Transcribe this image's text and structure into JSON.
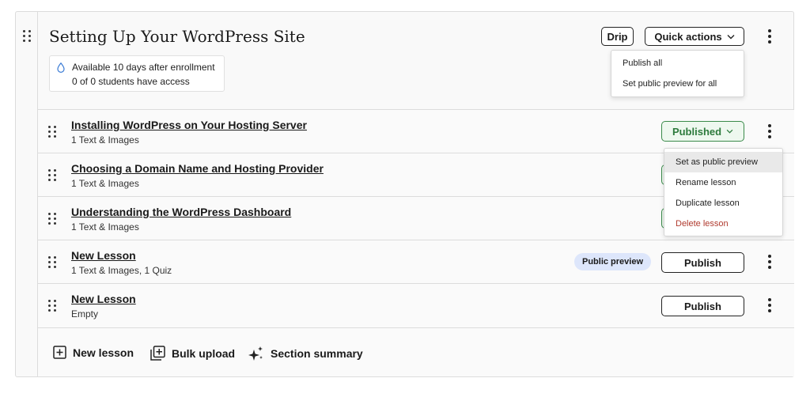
{
  "section": {
    "title": "Setting Up Your WordPress Site",
    "drip_line1": "Available 10 days after enrollment",
    "drip_line2": "0 of 0 students have access",
    "drip_button": "Drip",
    "quick_actions": "Quick actions",
    "quick_menu": [
      "Publish all",
      "Set public preview for all"
    ]
  },
  "lessons": [
    {
      "title": "Installing WordPress on Your Hosting Server",
      "subtitle": "1 Text & Images",
      "status": "Published"
    },
    {
      "title": "Choosing a Domain Name and Hosting Provider",
      "subtitle": "1 Text & Images"
    },
    {
      "title": "Understanding the WordPress Dashboard",
      "subtitle": "1 Text & Images"
    },
    {
      "title": "New Lesson",
      "subtitle": "1 Text & Images, 1 Quiz",
      "badge": "Public preview",
      "action": "Publish"
    },
    {
      "title": "New Lesson",
      "subtitle": "Empty",
      "action": "Publish"
    }
  ],
  "lesson_menu": [
    "Set as public preview",
    "Rename lesson",
    "Duplicate lesson",
    "Delete lesson"
  ],
  "colors": {
    "published": "#2d7a3c",
    "delete": "#b03a2e",
    "badge_bg": "#dde6fb",
    "hover": "#e9e9e9"
  },
  "footer": {
    "new_lesson": "New lesson",
    "bulk_upload": "Bulk upload",
    "section_summary": "Section summary"
  }
}
